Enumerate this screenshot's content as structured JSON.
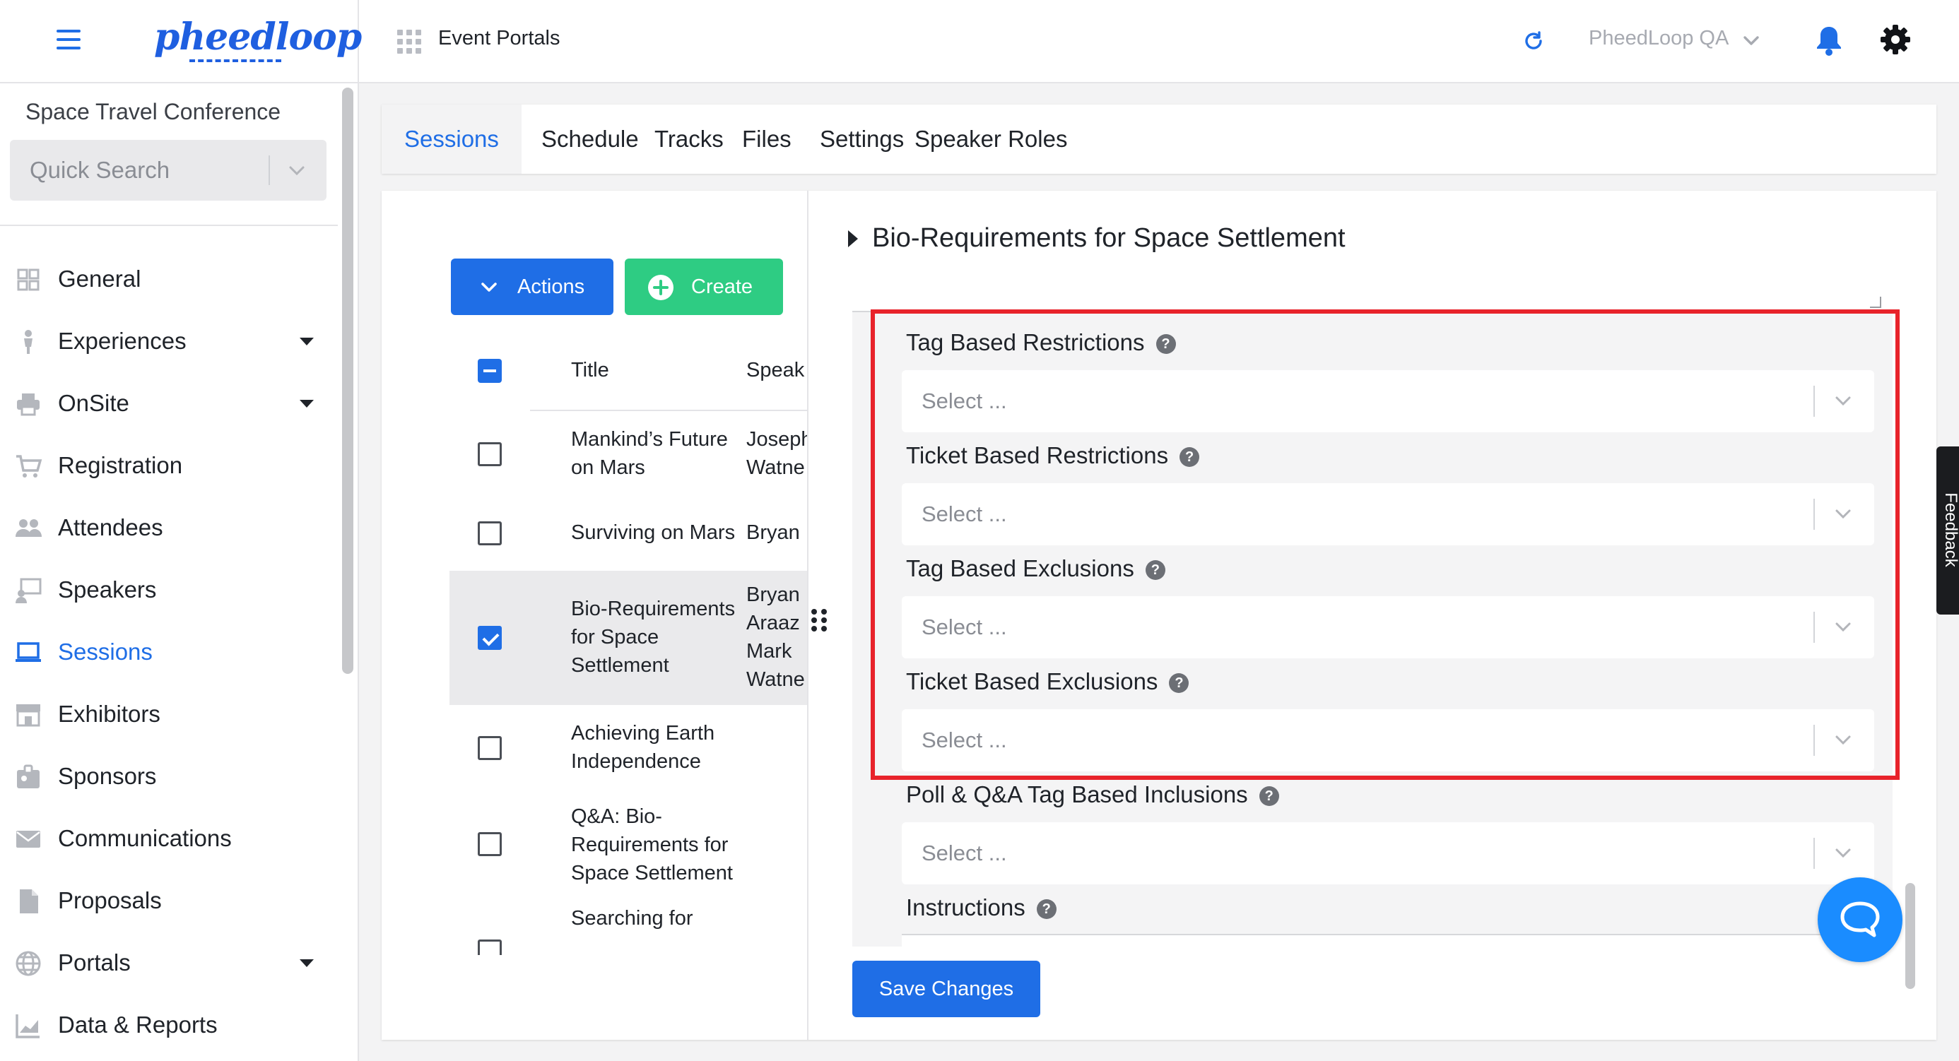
{
  "topbar": {
    "logo_text": "pheedloop",
    "title": "Event Portals",
    "account": "PheedLoop QA"
  },
  "sidebar": {
    "event_name": "Space Travel Conference",
    "search_placeholder": "Quick Search",
    "items": [
      {
        "label": "General",
        "icon": "grid-icon"
      },
      {
        "label": "Experiences",
        "icon": "person-icon",
        "expandable": true
      },
      {
        "label": "OnSite",
        "icon": "printer-icon",
        "expandable": true
      },
      {
        "label": "Registration",
        "icon": "cart-icon"
      },
      {
        "label": "Attendees",
        "icon": "people-icon"
      },
      {
        "label": "Speakers",
        "icon": "presenter-icon"
      },
      {
        "label": "Sessions",
        "icon": "laptop-icon",
        "active": true
      },
      {
        "label": "Exhibitors",
        "icon": "storefront-icon"
      },
      {
        "label": "Sponsors",
        "icon": "badge-icon"
      },
      {
        "label": "Communications",
        "icon": "envelope-icon"
      },
      {
        "label": "Proposals",
        "icon": "document-icon"
      },
      {
        "label": "Portals",
        "icon": "globe-icon",
        "expandable": true
      },
      {
        "label": "Data & Reports",
        "icon": "chart-icon"
      }
    ]
  },
  "tabs": [
    "Sessions",
    "Schedule",
    "Tracks",
    "Files",
    "Settings",
    "Speaker Roles"
  ],
  "actions": {
    "actions_label": "Actions",
    "create_label": "Create"
  },
  "table": {
    "col_title": "Title",
    "col_speaker": "Speak",
    "rows": [
      {
        "title": "Mankind’s Future on Mars",
        "speaker": "Joseph\nWatne",
        "checked": false
      },
      {
        "title": "Surviving on Mars",
        "speaker": "Bryan",
        "checked": false
      },
      {
        "title": "Bio-Requirements for Space Settlement",
        "speaker": "Bryan\nAraaz\nMark\nWatne",
        "checked": true
      },
      {
        "title": "Achieving Earth Independence",
        "speaker": "",
        "checked": false
      },
      {
        "title": "Q&A: Bio-Requirements for Space Settlement",
        "speaker": "",
        "checked": false
      },
      {
        "title": "Searching for",
        "speaker": "",
        "checked": false
      }
    ]
  },
  "detail": {
    "title": "Bio-Requirements for Space Settlement",
    "fields": [
      {
        "label": "Tag Based Restrictions",
        "placeholder": "Select ..."
      },
      {
        "label": "Ticket Based Restrictions",
        "placeholder": "Select ..."
      },
      {
        "label": "Tag Based Exclusions",
        "placeholder": "Select ..."
      },
      {
        "label": "Ticket Based Exclusions",
        "placeholder": "Select ..."
      },
      {
        "label": "Poll & Q&A Tag Based Inclusions",
        "placeholder": "Select ..."
      }
    ],
    "instructions_label": "Instructions",
    "help_glyph": "?",
    "save_label": "Save Changes"
  },
  "feedback_label": "Feedback",
  "colors": {
    "primary": "#1f6ee6",
    "create_green": "#2ecc83",
    "highlight_red": "#e8232b",
    "chat_blue": "#1a8cff"
  }
}
